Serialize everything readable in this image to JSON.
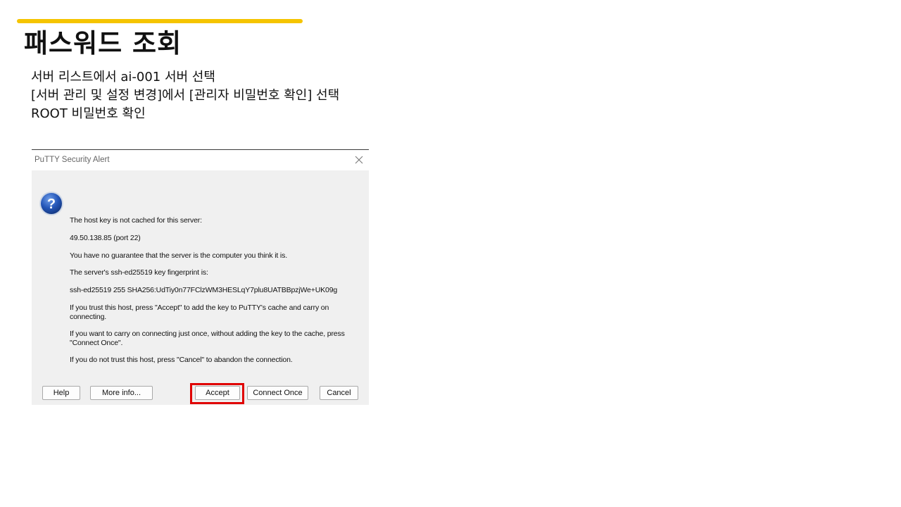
{
  "slide": {
    "title": "패스워드 조회",
    "instructions": [
      "서버 리스트에서 ai-001 서버 선택",
      "[서버 관리 및 설정 변경]에서 [관리자 비밀번호 확인] 선택",
      "ROOT 비밀번호 확인"
    ],
    "accent_color": "#f5c400",
    "highlight_color": "#e00000"
  },
  "dialog": {
    "title": "PuTTY Security Alert",
    "icon": "question-icon",
    "messages": [
      "The host key is not cached for this server:",
      "49.50.138.85 (port 22)",
      "You have no guarantee that the server is the computer you think it is.",
      "The server's ssh-ed25519 key fingerprint is:",
      "ssh-ed25519 255 SHA256:UdTiy0n77FClzWM3HESLqY7plu8UATBBpzjWe+UK09g",
      "If you trust this host, press \"Accept\" to add the key to PuTTY's cache and carry on connecting.",
      "If you want to carry on connecting just once, without adding the key to the cache, press \"Connect Once\".",
      "If you do not trust this host, press \"Cancel\" to abandon the connection."
    ],
    "buttons": {
      "help": "Help",
      "more_info": "More info...",
      "accept": "Accept",
      "connect_once": "Connect Once",
      "cancel": "Cancel"
    }
  }
}
